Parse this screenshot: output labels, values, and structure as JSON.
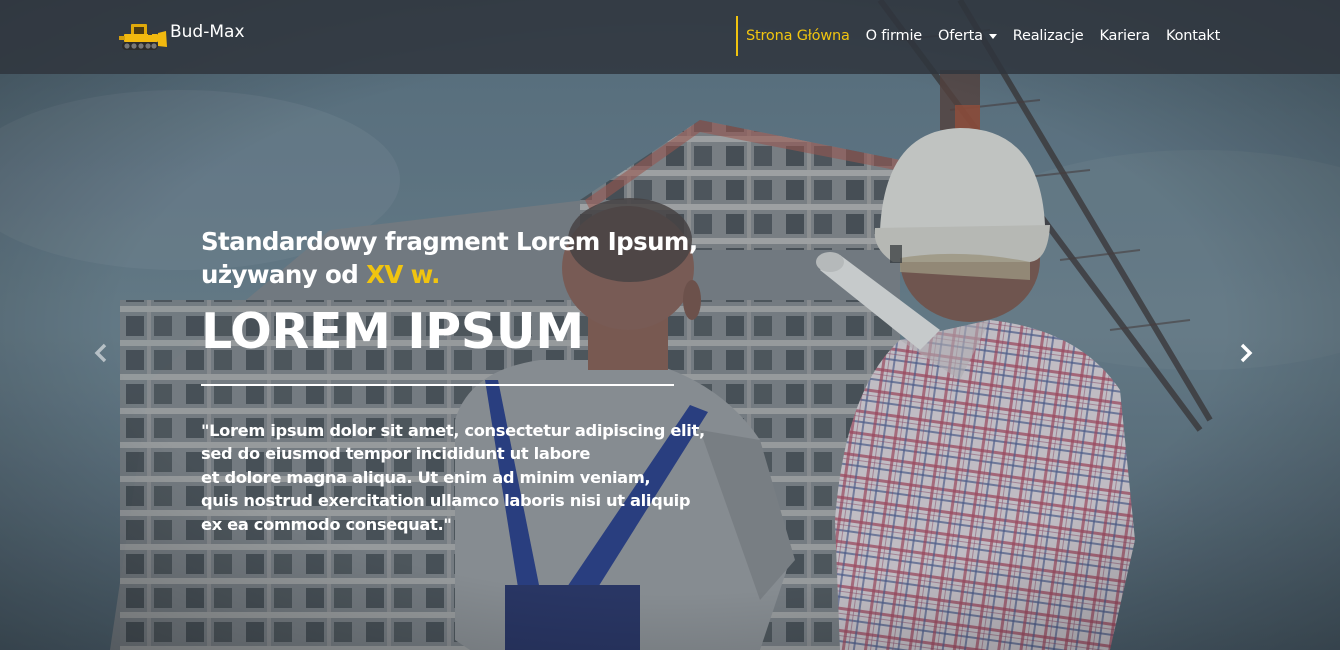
{
  "brand": {
    "name": "Bud-Max",
    "logo_icon": "bulldozer-icon"
  },
  "nav": {
    "items": [
      {
        "label": "Strona Główna",
        "active": true
      },
      {
        "label": "O firmie"
      },
      {
        "label": "Oferta",
        "dropdown": true
      },
      {
        "label": "Realizacje"
      },
      {
        "label": "Kariera"
      },
      {
        "label": "Kontakt"
      }
    ]
  },
  "hero": {
    "subtitle_line1": "Standardowy fragment Lorem Ipsum,",
    "subtitle_line2_prefix": "używany od ",
    "subtitle_line2_accent": "XV w.",
    "headline": "LOREM IPSUM",
    "quote_lines": [
      "\"Lorem ipsum dolor sit amet, consectetur adipiscing elit,",
      "sed do eiusmod tempor incididunt ut labore",
      "et dolore magna aliqua. Ut enim ad minim veniam,",
      "quis nostrud exercitation ullamco laboris nisi ut aliquip",
      "ex ea commodo consequat.\""
    ]
  },
  "carousel": {
    "prev_icon": "chevron-left-icon",
    "next_icon": "chevron-right-icon"
  },
  "colors": {
    "accent": "#f1c40f",
    "navbar_bg": "#30363e",
    "text": "#ffffff"
  }
}
